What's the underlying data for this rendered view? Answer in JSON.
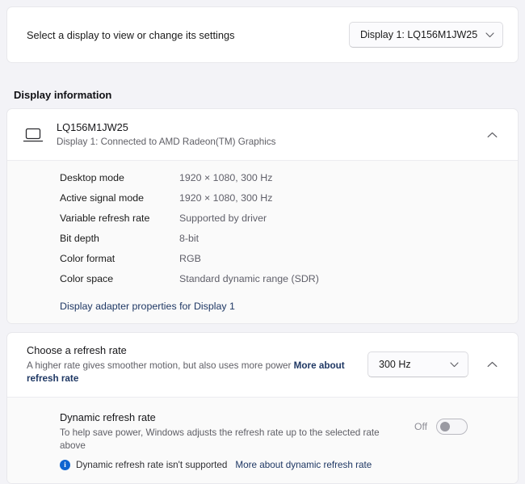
{
  "theme": {
    "page_background": "#f3f3f7",
    "card_background": "#ffffff",
    "expanded_background": "#fafafa",
    "link_color": "#1f3864",
    "info_badge_color": "#0f65d0",
    "secondary_text": "#5f5f66"
  },
  "select_display": {
    "label": "Select a display to view or change its settings",
    "dropdown_value": "Display 1: LQ156M1JW25",
    "dropdown_icon": "chevron-down-icon"
  },
  "display_information": {
    "section_heading": "Display information",
    "device_icon": "laptop-icon",
    "device_name": "LQ156M1JW25",
    "device_subtitle": "Display 1: Connected to AMD Radeon(TM) Graphics",
    "expander_icon": "chevron-up-icon",
    "expanded": true,
    "details": [
      {
        "key": "Desktop mode",
        "value": "1920 × 1080, 300 Hz"
      },
      {
        "key": "Active signal mode",
        "value": "1920 × 1080, 300 Hz"
      },
      {
        "key": "Variable refresh rate",
        "value": "Supported by driver"
      },
      {
        "key": "Bit depth",
        "value": "8-bit"
      },
      {
        "key": "Color format",
        "value": "RGB"
      },
      {
        "key": "Color space",
        "value": "Standard dynamic range (SDR)"
      }
    ],
    "adapter_link": "Display adapter properties for Display 1"
  },
  "refresh_rate": {
    "title": "Choose a refresh rate",
    "description": "A higher rate gives smoother motion, but also uses more power",
    "description_link": "More about refresh rate",
    "dropdown_value": "300 Hz",
    "dropdown_icon": "chevron-down-icon",
    "expander_icon": "chevron-up-icon",
    "expanded": true
  },
  "dynamic_refresh_rate": {
    "title": "Dynamic refresh rate",
    "description": "To help save power, Windows adjusts the refresh rate up to the selected rate above",
    "info_icon": "info-circle-icon",
    "note": "Dynamic refresh rate isn't supported",
    "note_link": "More about dynamic refresh rate",
    "toggle_state_label": "Off",
    "toggle_on": false
  }
}
